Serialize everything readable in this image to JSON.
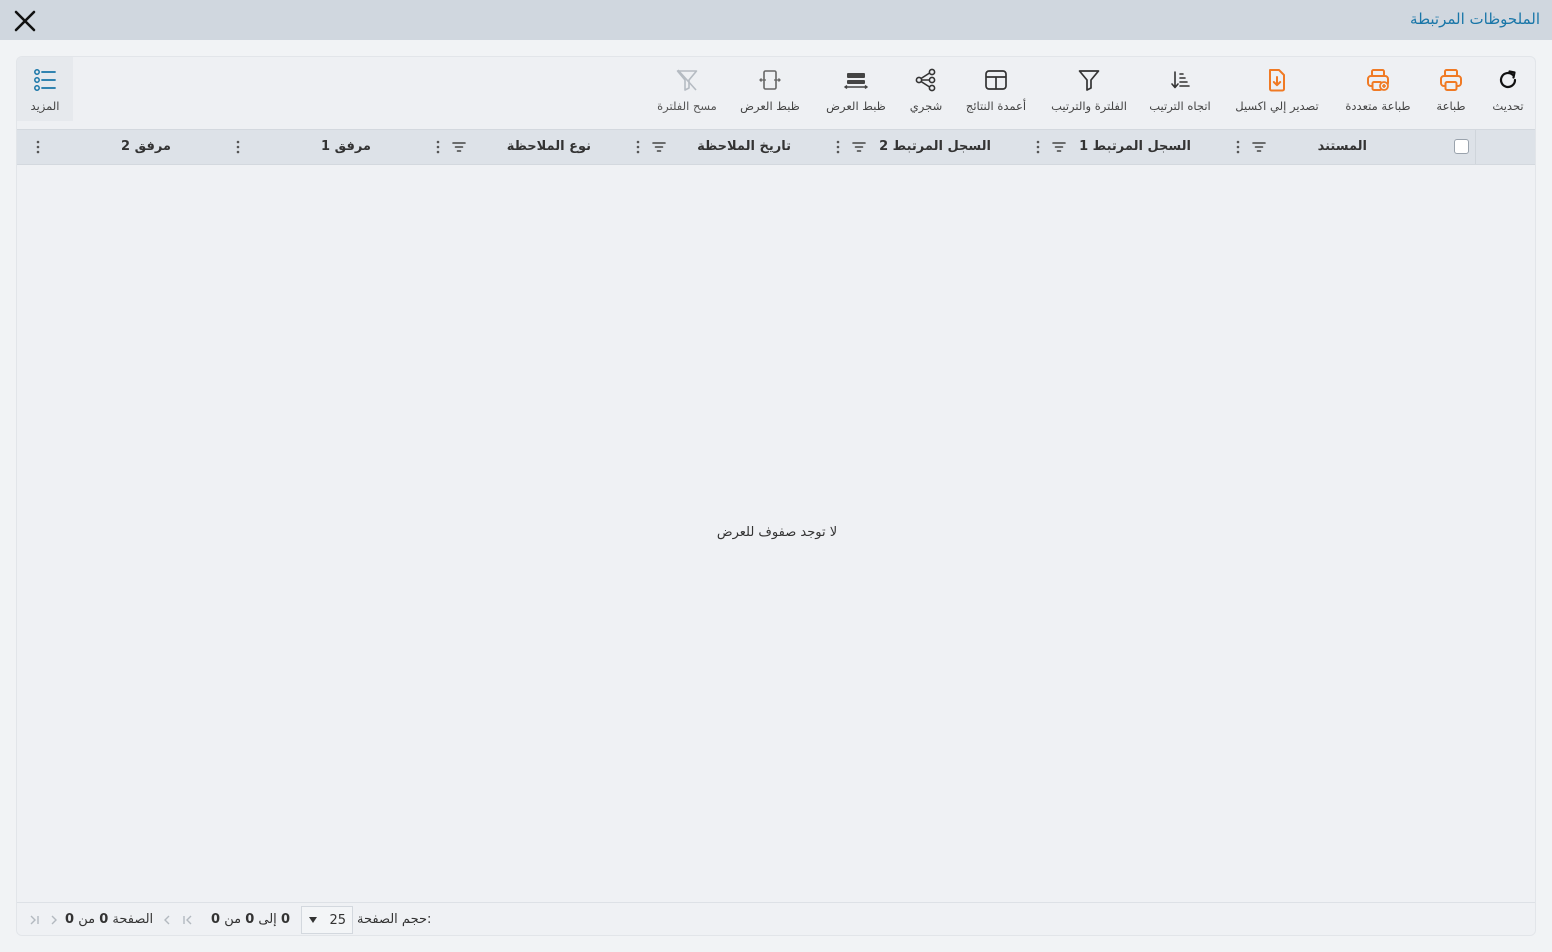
{
  "window": {
    "title": "الملحوظات المرتبطة",
    "close_icon": "close-icon"
  },
  "toolbar": {
    "refresh": "تحديث",
    "print": "طباعة",
    "multi_print": "طباعة متعددة",
    "export_excel": "تصدير إلي اكسيل",
    "sort_direction": "اتجاه الترتيب",
    "filter_sort": "الفلترة والترتيب",
    "result_columns": "أعمدة النتائج",
    "tree": "شجري",
    "fit_width_1": "ظبط العرض",
    "fit_width_2": "ظبط العرض",
    "clear_filter": "مسح الفلترة",
    "more": "المزيد"
  },
  "colors": {
    "accent": "#1976a8",
    "orange": "#f07a24",
    "title_bar": "#d0d7df"
  },
  "grid": {
    "columns": [
      "المستند",
      "السجل المرتبط 1",
      "السجل المرتبط 2",
      "تاريخ الملاحظة",
      "نوع الملاحظة",
      "مرفق 1",
      "مرفق 2"
    ],
    "empty_message": "لا توجد صفوف للعرض"
  },
  "pagination": {
    "page_size_label": "حجم الصفحة:",
    "page_size": "25",
    "range_from": "0",
    "range_to_word": "إلى",
    "range_to": "0",
    "of_word": "من",
    "total": "0",
    "page_word": "الصفحة",
    "page": "0",
    "page_of_word": "من",
    "page_total": "0"
  }
}
